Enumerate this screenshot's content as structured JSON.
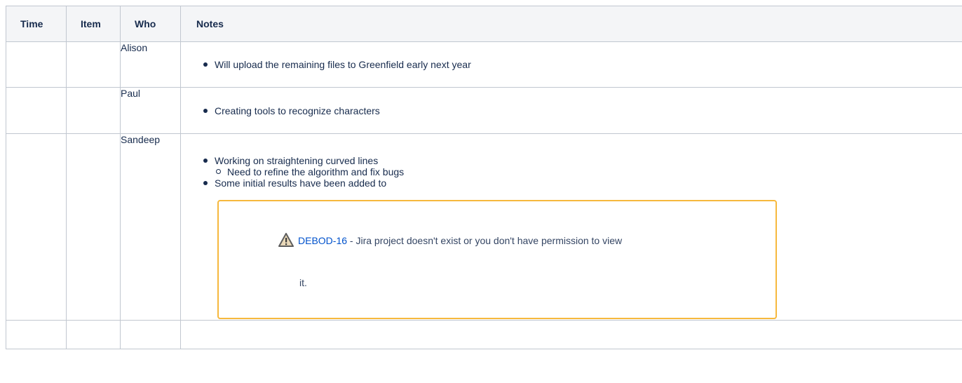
{
  "table": {
    "headers": {
      "time": "Time",
      "item": "Item",
      "who": "Who",
      "notes": "Notes"
    },
    "rows": [
      {
        "time": "",
        "item": "",
        "who": "Alison",
        "notes": [
          "Will upload the remaining files to Greenfield early next year"
        ]
      },
      {
        "time": "",
        "item": "",
        "who": "Paul",
        "notes": [
          "Creating tools to recognize characters"
        ]
      },
      {
        "time": "",
        "item": "",
        "who": "Sandeep",
        "notes": [
          "Working on straightening curved lines",
          "Some initial results have been added to"
        ],
        "subnotes": [
          "Need to refine the algorithm and fix bugs"
        ],
        "jira": {
          "key": "DEBOD-16",
          "message": " - Jira project doesn't exist or you don't have permission to view",
          "message_continued": "it.",
          "icon": "warning-icon",
          "border_color": "#f6b83d",
          "link_color": "#0052cc"
        }
      },
      {
        "time": "",
        "item": "",
        "who": "",
        "notes": []
      }
    ]
  }
}
